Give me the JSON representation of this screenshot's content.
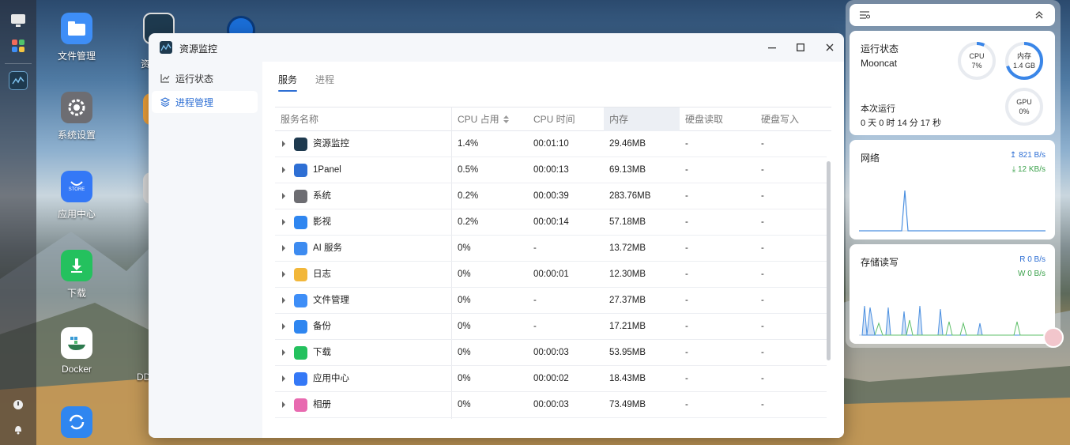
{
  "desktop": {
    "icons": [
      {
        "label": "文件管理",
        "icon": "folder-icon",
        "color": "#3e8ef7"
      },
      {
        "label": "系统设置",
        "icon": "gear-icon",
        "color": "#6d6d72"
      },
      {
        "label": "应用中心",
        "icon": "store-icon",
        "color": "#3478f6",
        "sub": "STORE"
      },
      {
        "label": "下载",
        "icon": "download-icon",
        "color": "#24c15e"
      },
      {
        "label": "Docker",
        "icon": "docker-icon",
        "color": "#ffffff"
      },
      {
        "label": "",
        "icon": "sync-icon",
        "color": "#2f86f0"
      }
    ],
    "partial_labels": {
      "col2_row1": "资",
      "col2_row5": "DD"
    }
  },
  "window": {
    "title": "资源监控",
    "sidebar": [
      {
        "label": "运行状态",
        "icon": "chart-line-icon"
      },
      {
        "label": "进程管理",
        "icon": "layers-icon",
        "active": true
      }
    ],
    "tabs": [
      {
        "label": "服务",
        "active": true
      },
      {
        "label": "进程",
        "active": false
      }
    ],
    "columns": [
      "服务名称",
      "CPU 占用",
      "CPU 时间",
      "内存",
      "硬盘读取",
      "硬盘写入"
    ],
    "rows": [
      {
        "name": "资源监控",
        "icon": "monitor-icon",
        "color": "#1e3a4f",
        "cpu": "1.4%",
        "time": "00:01:10",
        "mem": "29.46MB",
        "read": "-",
        "write": "-"
      },
      {
        "name": "1Panel",
        "icon": "panel-icon",
        "color": "#2e6fd4",
        "cpu": "0.5%",
        "time": "00:00:13",
        "mem": "69.13MB",
        "read": "-",
        "write": "-"
      },
      {
        "name": "系统",
        "icon": "gear-icon",
        "color": "#6d6d72",
        "cpu": "0.2%",
        "time": "00:00:39",
        "mem": "283.76MB",
        "read": "-",
        "write": "-"
      },
      {
        "name": "影视",
        "icon": "video-icon",
        "color": "#2f86f0",
        "cpu": "0.2%",
        "time": "00:00:14",
        "mem": "57.18MB",
        "read": "-",
        "write": "-"
      },
      {
        "name": "AI 服务",
        "icon": "ai-icon",
        "color": "#3d8bf0",
        "cpu": "0%",
        "time": "-",
        "mem": "13.72MB",
        "read": "-",
        "write": "-"
      },
      {
        "name": "日志",
        "icon": "log-icon",
        "color": "#f2b73a",
        "cpu": "0%",
        "time": "00:00:01",
        "mem": "12.30MB",
        "read": "-",
        "write": "-"
      },
      {
        "name": "文件管理",
        "icon": "folder-icon",
        "color": "#3e8ef7",
        "cpu": "0%",
        "time": "-",
        "mem": "27.37MB",
        "read": "-",
        "write": "-"
      },
      {
        "name": "备份",
        "icon": "backup-icon",
        "color": "#2f86f0",
        "cpu": "0%",
        "time": "-",
        "mem": "17.21MB",
        "read": "-",
        "write": "-"
      },
      {
        "name": "下载",
        "icon": "download-icon",
        "color": "#24c15e",
        "cpu": "0%",
        "time": "00:00:03",
        "mem": "53.95MB",
        "read": "-",
        "write": "-"
      },
      {
        "name": "应用中心",
        "icon": "store-icon",
        "color": "#3478f6",
        "cpu": "0%",
        "time": "00:00:02",
        "mem": "18.43MB",
        "read": "-",
        "write": "-"
      },
      {
        "name": "相册",
        "icon": "photos-icon",
        "color": "#e86ab0",
        "cpu": "0%",
        "time": "00:00:03",
        "mem": "73.49MB",
        "read": "-",
        "write": "-"
      }
    ]
  },
  "widget": {
    "status": {
      "title": "运行状态",
      "host": "Mooncat",
      "uptime_label": "本次运行",
      "uptime": "0 天 0 时 14 分 17 秒",
      "cpu_label": "CPU",
      "cpu_value": "7%",
      "cpu_fraction": 0.07,
      "mem_label": "内存",
      "mem_value": "1.4 GB",
      "mem_fraction": 0.7,
      "gpu_label": "GPU",
      "gpu_value": "0%",
      "gpu_fraction": 0
    },
    "network": {
      "title": "网络",
      "up": "821 B/s",
      "down": "12 KB/s"
    },
    "storage": {
      "title": "存储读写",
      "read": "R 0 B/s",
      "write": "W 0 B/s"
    }
  },
  "colors": {
    "accent": "#2e6fd4",
    "green": "#3aa14a"
  }
}
